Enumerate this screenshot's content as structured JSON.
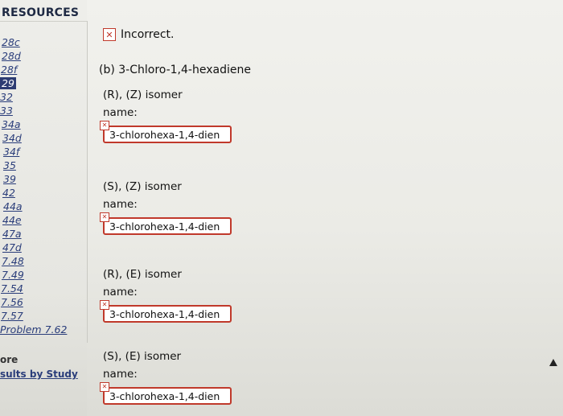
{
  "sidebar": {
    "title": "RESOURCES",
    "items": [
      "28c",
      "28d",
      "28f",
      "29",
      "32",
      "33",
      "34a",
      "34d",
      "34f",
      "35",
      "39",
      "42",
      "44a",
      "44e",
      "47a",
      "47d",
      "7.48",
      "7.49",
      "7.54",
      "7.56",
      "7.57",
      "Problem 7.62"
    ],
    "current_item": "29",
    "more_title": "ore",
    "results_link": "sults by Study"
  },
  "status": {
    "text": "Incorrect.",
    "icon": "x-icon",
    "color": "#c0392b"
  },
  "question": "(b) 3-Chloro-1,4-hexadiene",
  "answers": [
    {
      "isomer": "(R), (Z) isomer",
      "name_label": "name:",
      "value": "3-chlorohexa-1,4-dien"
    },
    {
      "isomer": "(S), (Z) isomer",
      "name_label": "name:",
      "value": "3-chlorohexa-1,4-dien"
    },
    {
      "isomer": "(R), (E) isomer",
      "name_label": "name:",
      "value": "3-chlorohexa-1,4-dien"
    },
    {
      "isomer": "(S), (E) isomer",
      "name_label": "name:",
      "value": "3-chlorohexa-1,4-dien"
    }
  ]
}
